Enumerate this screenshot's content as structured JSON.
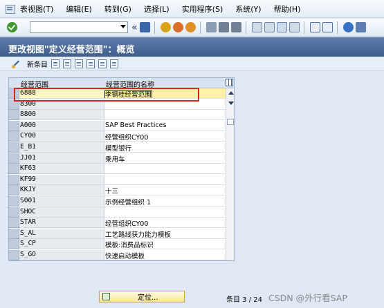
{
  "menubar": {
    "items": [
      "表视图(T)",
      "编辑(E)",
      "转到(G)",
      "选择(L)",
      "实用程序(S)",
      "系统(Y)",
      "帮助(H)"
    ]
  },
  "toolbar": {
    "command_field_value": "",
    "back_symbol": "«",
    "icon_colors": {
      "ok": "#3a9a2a",
      "save": "#3b67a8",
      "back": "#d8a21a",
      "exit": "#d9702a",
      "cancel": "#e0902a",
      "help": "#3771c4"
    }
  },
  "title": "更改视图\"定义经营范围\"：概览",
  "app_toolbar": {
    "new_entries_label": "新条目"
  },
  "table": {
    "headers": [
      "经营范围",
      "经营范围的名称"
    ],
    "rows": [
      {
        "code": "6888",
        "name": "李钢桂经营范围",
        "editing": true
      },
      {
        "code": "8300",
        "name": ""
      },
      {
        "code": "8800",
        "name": ""
      },
      {
        "code": "A000",
        "name": "SAP Best Practices"
      },
      {
        "code": "CY00",
        "name": "经营组织CY00"
      },
      {
        "code": "E_B1",
        "name": "模型银行"
      },
      {
        "code": "JJ01",
        "name": "乘用车"
      },
      {
        "code": "KF63",
        "name": ""
      },
      {
        "code": "KF99",
        "name": ""
      },
      {
        "code": "KKJY",
        "name": "十三"
      },
      {
        "code": "S001",
        "name": "示例经营组织 1"
      },
      {
        "code": "SHOC",
        "name": ""
      },
      {
        "code": "STAR",
        "name": "经营组织CY00"
      },
      {
        "code": "S_AL",
        "name": "工艺路线获力能力模板"
      },
      {
        "code": "S_CP",
        "name": "模板:消费品标识"
      },
      {
        "code": "S_GO",
        "name": "快速启动模板"
      }
    ]
  },
  "footer": {
    "position_button_label": "定位...",
    "entry_label": "条目 3 / 24",
    "watermark": "CSDN @外行看SAP"
  },
  "colors": {
    "title_bar": "#4a6a99",
    "highlight_box": "#e02020",
    "editing_cell": "#fff2a8"
  }
}
